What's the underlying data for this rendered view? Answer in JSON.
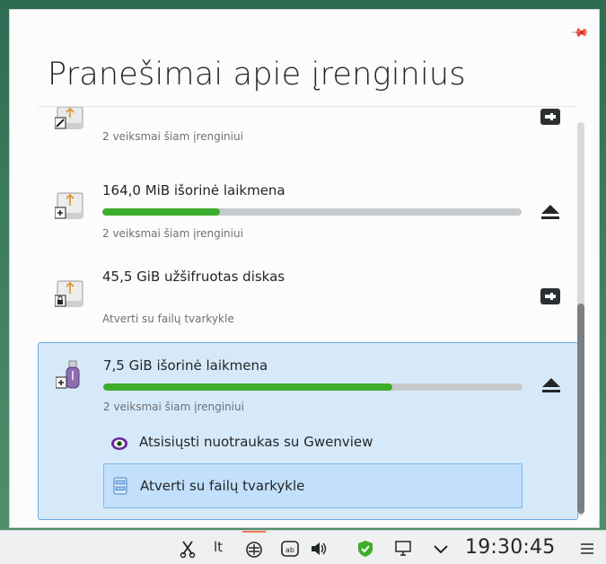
{
  "popup": {
    "title": "Pranešimai apie įrenginius"
  },
  "devices": [
    {
      "name": "",
      "subtitle": "2 veiksmai šiam įrenginiui",
      "action_icon": "unlock-icon",
      "progress_pct": null
    },
    {
      "name": "164,0 MiB išorinė laikmena",
      "subtitle": "2 veiksmai šiam įrenginiui",
      "action_icon": "eject-icon",
      "progress_pct": 28
    },
    {
      "name": "45,5 GiB užšifruotas diskas",
      "subtitle": "Atverti su failų tvarkykle",
      "action_icon": "unlock-icon",
      "progress_pct": null
    },
    {
      "name": "7,5 GiB išorinė laikmena",
      "subtitle": "2 veiksmai šiam įrenginiui",
      "action_icon": "eject-icon",
      "progress_pct": 69,
      "actions": [
        {
          "label": "Atsisiųsti nuotraukas su Gwenview",
          "icon": "gwenview-icon"
        },
        {
          "label": "Atverti su failų tvarkykle",
          "icon": "file-manager-icon"
        }
      ]
    }
  ],
  "taskbar": {
    "tray_lang": "lt",
    "clock": "19:30:45",
    "icons": [
      "scissors-icon",
      "language-indicator",
      "network-icon",
      "clipboard-icon",
      "volume-icon",
      "shield-icon",
      "display-icon",
      "chevron-down-icon",
      "menu-icon"
    ]
  },
  "colors": {
    "progress": "#3dae2b",
    "selection": "#d6e9f9",
    "selection_border": "#6aaee8",
    "accent": "#f47750"
  }
}
